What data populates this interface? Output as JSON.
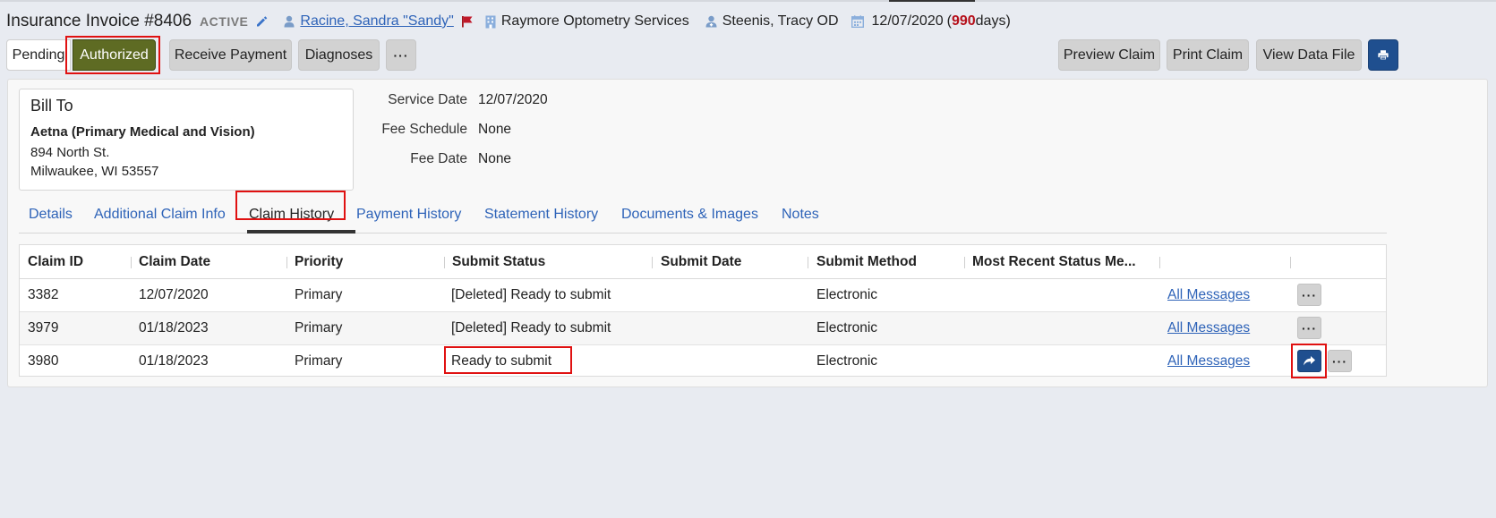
{
  "header": {
    "title": "Insurance Invoice #8406",
    "status": "ACTIVE",
    "patient": "Racine, Sandra \"Sandy\"",
    "location": "Raymore Optometry Services",
    "provider": "Steenis, Tracy OD",
    "date": "12/07/2020",
    "days_open": "(",
    "days_count": "990",
    "days_close": " days)"
  },
  "toolbar": {
    "pending": "Pending",
    "authorized": "Authorized",
    "receive_payment": "Receive Payment",
    "diagnoses": "Diagnoses",
    "more": "···",
    "preview_claim": "Preview Claim",
    "print_claim": "Print Claim",
    "view_data_file": "View Data File"
  },
  "bill_to": {
    "heading": "Bill To",
    "name": "Aetna (Primary Medical and Vision)",
    "address1": "894 North St.",
    "address2": "Milwaukee, WI 53557"
  },
  "fields": [
    {
      "label": "Service Date",
      "value": "12/07/2020"
    },
    {
      "label": "Fee Schedule",
      "value": "None"
    },
    {
      "label": "Fee Date",
      "value": "None"
    }
  ],
  "tabs": [
    "Details",
    "Additional Claim Info",
    "Claim History",
    "Payment History",
    "Statement History",
    "Documents & Images",
    "Notes"
  ],
  "active_tab": "Claim History",
  "table": {
    "columns": [
      "Claim ID",
      "Claim Date",
      "Priority",
      "Submit Status",
      "Submit Date",
      "Submit Method",
      "Most Recent Status Me..."
    ],
    "rows": [
      {
        "claim_id": "3382",
        "claim_date": "12/07/2020",
        "priority": "Primary",
        "submit_status": "[Deleted] Ready to submit",
        "submit_date": "",
        "submit_method": "Electronic",
        "messages": "All Messages"
      },
      {
        "claim_id": "3979",
        "claim_date": "01/18/2023",
        "priority": "Primary",
        "submit_status": "[Deleted] Ready to submit",
        "submit_date": "",
        "submit_method": "Electronic",
        "messages": "All Messages"
      },
      {
        "claim_id": "3980",
        "claim_date": "01/18/2023",
        "priority": "Primary",
        "submit_status": "Ready to submit",
        "submit_date": "",
        "submit_method": "Electronic",
        "messages": "All Messages"
      }
    ],
    "more": "···"
  },
  "icons": {
    "edit": "pencil-icon",
    "patient": "user-icon",
    "flag": "flag-icon",
    "location": "building-icon",
    "provider": "doctor-icon",
    "date": "calendar-icon",
    "print": "printer-icon",
    "submit": "share-arrow-icon"
  },
  "colors": {
    "authorized": "#5e6b23",
    "link": "#2e63b8",
    "primary": "#1f4f8f",
    "days_warning": "#b50f1a",
    "highlight": "#e01111"
  }
}
